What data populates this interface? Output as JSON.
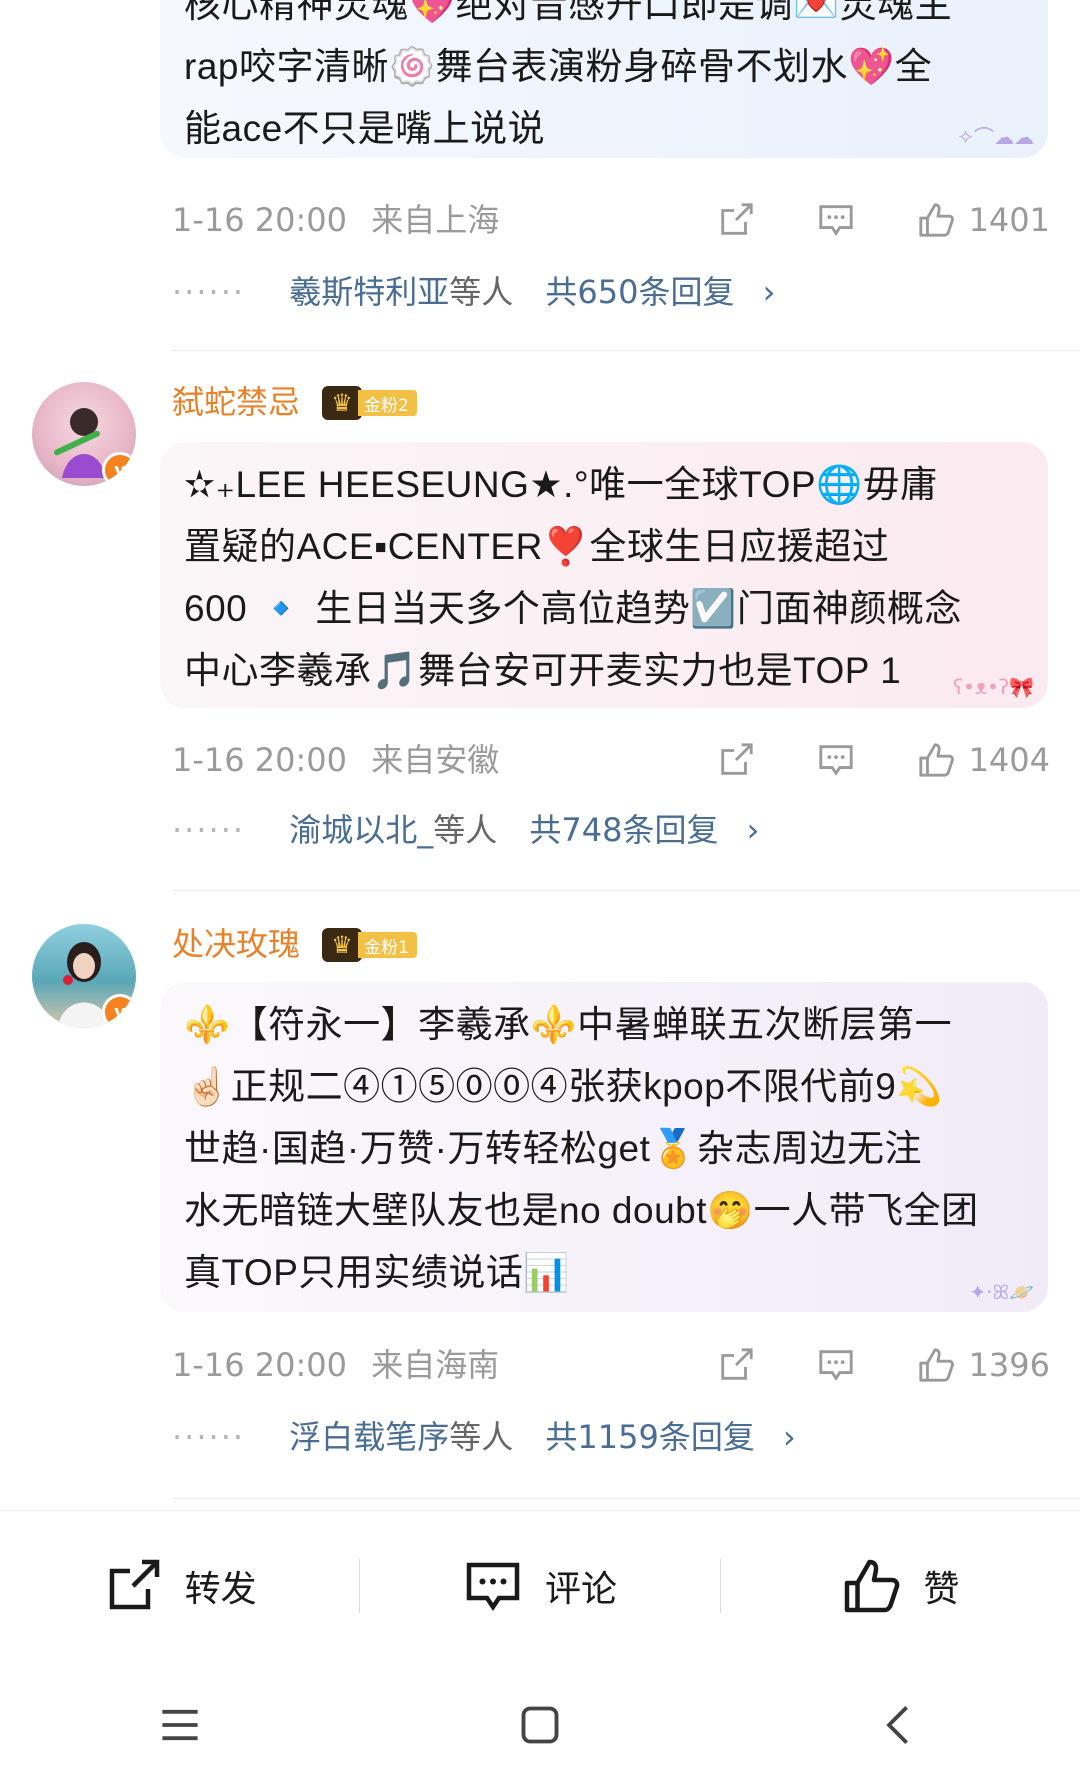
{
  "comments": [
    {
      "text_lines": [
        "核心精神灵魂💖绝对音感开口即是调💌灵魂主",
        "rap咬字清晰🍥舞台表演粉身碎骨不划水💖全",
        "能ace不只是嘴上说说"
      ],
      "timestamp": "1-16 20:00",
      "location": "来自上海",
      "likes": "1401",
      "reply_names": "羲斯特利亚",
      "reply_who": "等人",
      "reply_total": "共650条回复"
    },
    {
      "username": "弑蛇禁忌",
      "fan_badge": "金粉2",
      "text_lines": [
        "✫₊LEE HEESEUNG★.°唯一全球TOP🌐毋庸",
        "置疑的ACE▪CENTER❣️全球生日应援超过",
        "600 🔹 生日当天多个高位趋势☑️门面神颜概念",
        "中心李羲承🎵舞台安可开麦实力也是TOP 1"
      ],
      "timestamp": "1-16 20:00",
      "location": "来自安徽",
      "likes": "1404",
      "reply_names": "渝城以北_",
      "reply_who": "等人",
      "reply_total": "共748条回复"
    },
    {
      "username": "处决玫瑰",
      "fan_badge": "金粉1",
      "text_lines": [
        "⚜️【符永一】李羲承⚜️中暑蝉联五次断层第一",
        "☝🏻正规二④①⑤⓪⓪④张获kpop不限代前9💫",
        "世趋·国趋·万赞·万转轻松get🏅杂志周边无注",
        "水无暗链大壁队友也是no doubt🤭一人带飞全团",
        "真TOP只用实绩说话📊"
      ],
      "timestamp": "1-16 20:00",
      "location": "来自海南",
      "likes": "1396",
      "reply_names": "浮白载笔序",
      "reply_who": "等人",
      "reply_total": "共1159条回复"
    }
  ],
  "bottom_bar": {
    "repost": "转发",
    "comment": "评论",
    "like": "赞"
  },
  "colors": {
    "username": "#e8822a",
    "reply_link": "#4a6d94",
    "meta": "#9a9a9a",
    "annotation_red": "#e8231a"
  }
}
